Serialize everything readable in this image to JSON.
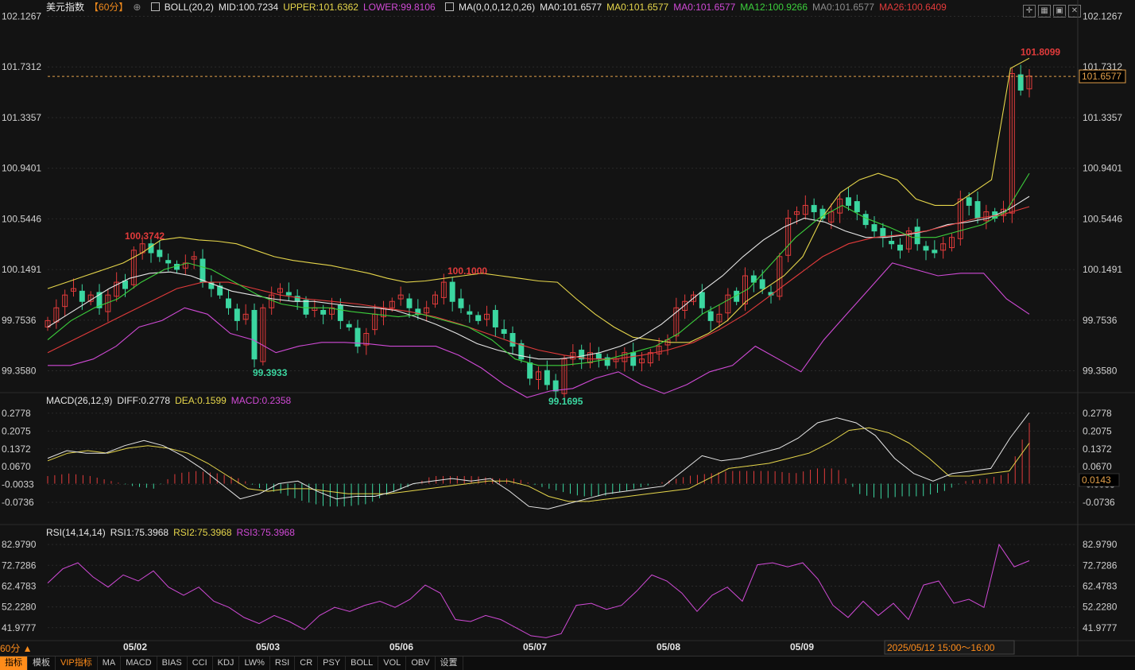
{
  "header": {
    "symbol": "美元指数",
    "period_tag": "【60分】",
    "boll_label": "BOLL(20,2)",
    "boll_mid": "MID:100.7234",
    "boll_upper": "UPPER:101.6362",
    "boll_lower": "LOWER:99.8106",
    "ma_label": "MA(0,0,0,12,0,26)",
    "ma0_a": "MA0:101.6577",
    "ma0_b": "MA0:101.6577",
    "ma0_c": "MA0:101.6577",
    "ma12": "MA12:100.9266",
    "ma0_d": "MA0:101.6577",
    "ma26": "MA26:100.6409"
  },
  "macd_header": {
    "label": "MACD(26,12,9)",
    "diff": "DIFF:0.2778",
    "dea": "DEA:0.1599",
    "macd": "MACD:0.2358"
  },
  "rsi_header": {
    "label": "RSI(14,14,14)",
    "rsi1": "RSI1:75.3968",
    "rsi2": "RSI2:75.3968",
    "rsi3": "RSI3:75.3968"
  },
  "price_axis": [
    "102.1267",
    "101.7312",
    "101.3357",
    "100.9401",
    "100.5446",
    "100.1491",
    "99.7536",
    "99.3580"
  ],
  "macd_axis": [
    "0.2778",
    "0.2075",
    "0.1372",
    "0.0670",
    "-0.0033",
    "-0.0736"
  ],
  "rsi_axis": [
    "82.9790",
    "72.7286",
    "62.4783",
    "52.2280",
    "41.9777"
  ],
  "current_price_tag": "101.6577",
  "current_macd_tag": "0.0143",
  "annotations": {
    "high": "101.8099",
    "peak1": "100.3742",
    "peak2": "100.1000",
    "low1": "99.3933",
    "low2": "99.1695"
  },
  "date_labels": [
    "05/02",
    "05/03",
    "05/06",
    "05/07",
    "05/08",
    "05/09"
  ],
  "cursor_time": "2025/05/12 15:00～16:00",
  "period_button": "60分 ▲",
  "tabs": [
    "指标",
    "模板",
    "VIP指标",
    "MA",
    "MACD",
    "BIAS",
    "CCI",
    "KDJ",
    "LW%",
    "RSI",
    "CR",
    "PSY",
    "BOLL",
    "VOL",
    "OBV",
    "设置"
  ],
  "colors": {
    "up": "#e23b3b",
    "down": "#3bd6a0",
    "mid": "#e6e6e6",
    "upper": "#e6d64b",
    "lower": "#d04ad6",
    "ma12": "#3ccf3c",
    "ma26": "#e23b3b"
  },
  "chart_data": [
    {
      "type": "candlestick",
      "title": "美元指数 60分",
      "ylim": [
        99.2,
        102.13
      ],
      "dates": [
        "05/02",
        "05/03",
        "05/06",
        "05/07",
        "05/08",
        "05/09"
      ],
      "close_path": [
        99.75,
        99.85,
        99.95,
        100.0,
        99.9,
        99.95,
        99.85,
        99.95,
        100.05,
        100.0,
        100.3,
        100.35,
        100.28,
        100.25,
        100.2,
        100.15,
        100.2,
        100.25,
        100.05,
        100.0,
        99.95,
        99.85,
        99.75,
        99.8,
        99.45,
        99.85,
        99.95,
        100.0,
        99.95,
        99.9,
        99.8,
        99.85,
        99.8,
        99.85,
        99.75,
        99.7,
        99.55,
        99.65,
        99.8,
        99.85,
        99.9,
        99.95,
        99.85,
        99.8,
        99.85,
        99.95,
        100.05,
        99.9,
        99.85,
        99.8,
        99.75,
        99.8,
        99.7,
        99.65,
        99.55,
        99.45,
        99.3,
        99.35,
        99.25,
        99.2,
        99.45,
        99.5,
        99.45,
        99.5,
        99.45,
        99.4,
        99.45,
        99.5,
        99.4,
        99.45,
        99.5,
        99.55,
        99.6,
        99.85,
        99.9,
        99.95,
        99.85,
        99.75,
        99.8,
        99.95,
        99.9,
        100.1,
        100.05,
        100.0,
        99.95,
        100.25,
        100.55,
        100.6,
        100.65,
        100.6,
        100.55,
        100.6,
        100.7,
        100.65,
        100.6,
        100.5,
        100.45,
        100.4,
        100.35,
        100.3,
        100.45,
        100.35,
        100.3,
        100.28,
        100.35,
        100.4,
        100.7,
        100.65,
        100.55,
        100.6,
        100.55,
        100.62,
        101.68,
        101.55,
        101.66
      ],
      "boll_upper": [
        100.0,
        100.05,
        100.1,
        100.15,
        100.2,
        100.28,
        100.38,
        100.4,
        100.38,
        100.37,
        100.35,
        100.3,
        100.25,
        100.22,
        100.2,
        100.18,
        100.15,
        100.12,
        100.08,
        100.05,
        100.06,
        100.08,
        100.1,
        100.12,
        100.1,
        100.08,
        100.06,
        100.05,
        99.92,
        99.8,
        99.7,
        99.62,
        99.6,
        99.58,
        99.58,
        99.65,
        99.75,
        99.9,
        100.0,
        100.1,
        100.25,
        100.55,
        100.75,
        100.85,
        100.9,
        100.85,
        100.7,
        100.65,
        100.65,
        100.75,
        100.85,
        101.72,
        101.8
      ],
      "boll_mid": [
        99.7,
        99.8,
        99.9,
        100.0,
        100.08,
        100.12,
        100.13,
        100.1,
        100.04,
        99.98,
        99.95,
        99.92,
        99.9,
        99.9,
        99.88,
        99.86,
        99.85,
        99.83,
        99.78,
        99.72,
        99.65,
        99.57,
        99.52,
        99.48,
        99.45,
        99.45,
        99.47,
        99.5,
        99.55,
        99.62,
        99.72,
        99.85,
        99.98,
        100.1,
        100.25,
        100.38,
        100.48,
        100.55,
        100.52,
        100.45,
        100.4,
        100.4,
        100.42,
        100.45,
        100.5,
        100.52,
        100.55,
        100.62,
        100.72
      ],
      "boll_lower": [
        99.4,
        99.4,
        99.45,
        99.55,
        99.7,
        99.75,
        99.85,
        99.8,
        99.65,
        99.6,
        99.5,
        99.55,
        99.58,
        99.58,
        99.57,
        99.55,
        99.55,
        99.55,
        99.48,
        99.38,
        99.25,
        99.15,
        99.2,
        99.22,
        99.3,
        99.35,
        99.25,
        99.18,
        99.25,
        99.35,
        99.4,
        99.55,
        99.45,
        99.35,
        99.6,
        99.8,
        100.0,
        100.2,
        100.15,
        100.1,
        100.12,
        100.12,
        99.92,
        99.8
      ],
      "ma12": [
        99.6,
        99.75,
        99.85,
        99.92,
        100.05,
        100.15,
        100.2,
        100.15,
        100.05,
        99.95,
        99.88,
        99.85,
        99.85,
        99.82,
        99.8,
        99.78,
        99.8,
        99.75,
        99.7,
        99.6,
        99.45,
        99.4,
        99.4,
        99.42,
        99.45,
        99.5,
        99.55,
        99.65,
        99.8,
        99.9,
        100.0,
        100.2,
        100.4,
        100.55,
        100.65,
        100.55,
        100.48,
        100.4,
        100.4,
        100.45,
        100.5,
        100.6,
        100.9
      ],
      "ma26": [
        99.5,
        99.6,
        99.7,
        99.8,
        99.9,
        100.0,
        100.05,
        100.05,
        100.0,
        99.95,
        99.92,
        99.9,
        99.88,
        99.85,
        99.82,
        99.78,
        99.72,
        99.65,
        99.58,
        99.52,
        99.48,
        99.45,
        99.45,
        99.48,
        99.52,
        99.58,
        99.68,
        99.8,
        99.95,
        100.1,
        100.25,
        100.35,
        100.4,
        100.42,
        100.45,
        100.5,
        100.55,
        100.58,
        100.64
      ]
    },
    {
      "type": "line",
      "title": "MACD(26,12,9)",
      "ylim": [
        -0.13,
        0.29
      ],
      "series": [
        {
          "name": "DIFF",
          "values": [
            0.1,
            0.13,
            0.12,
            0.12,
            0.15,
            0.17,
            0.15,
            0.11,
            0.06,
            0.0,
            -0.06,
            -0.04,
            0.0,
            0.01,
            -0.03,
            -0.06,
            -0.05,
            -0.05,
            -0.03,
            0.0,
            0.01,
            0.02,
            0.01,
            0.02,
            -0.03,
            -0.09,
            -0.1,
            -0.08,
            -0.06,
            -0.04,
            -0.03,
            -0.02,
            -0.01,
            0.05,
            0.11,
            0.09,
            0.1,
            0.12,
            0.14,
            0.18,
            0.24,
            0.26,
            0.24,
            0.19,
            0.1,
            0.04,
            0.01,
            0.04,
            0.05,
            0.06,
            0.18,
            0.28
          ]
        },
        {
          "name": "DEA",
          "values": [
            0.09,
            0.12,
            0.13,
            0.12,
            0.14,
            0.15,
            0.14,
            0.12,
            0.08,
            0.03,
            -0.02,
            -0.03,
            -0.02,
            -0.02,
            -0.03,
            -0.04,
            -0.04,
            -0.04,
            -0.03,
            -0.02,
            -0.01,
            0.0,
            0.01,
            0.01,
            -0.01,
            -0.05,
            -0.07,
            -0.07,
            -0.06,
            -0.05,
            -0.04,
            -0.03,
            -0.02,
            0.02,
            0.06,
            0.07,
            0.08,
            0.1,
            0.12,
            0.16,
            0.21,
            0.22,
            0.2,
            0.16,
            0.1,
            0.03,
            0.03,
            0.04,
            0.05,
            0.16
          ]
        },
        {
          "name": "MACD",
          "values": [
            0.03,
            0.04,
            0.03,
            0.01,
            -0.01,
            -0.02,
            0.04,
            0.05,
            0.04,
            0.02,
            -0.02,
            -0.04,
            -0.07,
            -0.09,
            -0.09,
            -0.08,
            -0.04,
            -0.01,
            0.03,
            0.03,
            0.03,
            0.02,
            0.02,
            -0.01,
            -0.03,
            -0.05,
            -0.05,
            -0.03,
            -0.01,
            0.01,
            0.03,
            0.04,
            0.05,
            0.05,
            0.05,
            0.04,
            0.06,
            0.06,
            -0.04,
            -0.06,
            -0.05,
            -0.05,
            -0.03,
            0.01,
            0.02,
            0.04,
            0.24
          ]
        }
      ]
    },
    {
      "type": "line",
      "title": "RSI(14,14,14)",
      "ylim": [
        36,
        85
      ],
      "series": [
        {
          "name": "RSI1",
          "values": [
            64,
            71,
            74,
            67,
            62,
            68,
            65,
            70,
            62,
            58,
            62,
            55,
            52,
            47,
            44,
            48,
            45,
            41,
            48,
            52,
            50,
            53,
            55,
            52,
            56,
            63,
            59,
            46,
            45,
            48,
            46,
            42,
            38,
            37,
            39,
            53,
            54,
            51,
            53,
            60,
            68,
            65,
            59,
            50,
            58,
            62,
            55,
            73,
            74,
            72,
            74,
            66,
            53,
            47,
            55,
            48,
            54,
            46,
            63,
            65,
            54,
            56,
            52,
            83,
            72,
            75
          ]
        }
      ]
    }
  ]
}
